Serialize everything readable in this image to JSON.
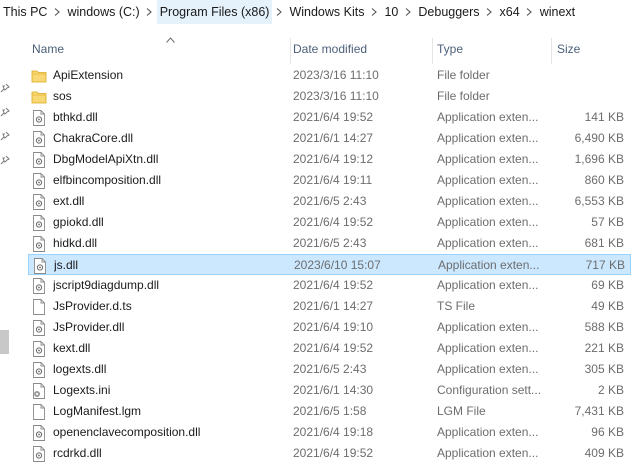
{
  "breadcrumb": {
    "items": [
      "This PC",
      "windows (C:)",
      "Program Files (x86)",
      "Windows Kits",
      "10",
      "Debuggers",
      "x64",
      "winext"
    ]
  },
  "columns": {
    "name": "Name",
    "date": "Date modified",
    "type": "Type",
    "size": "Size"
  },
  "colors": {
    "selected_row_bg": "#cce8ff",
    "selected_row_border": "#99d1ff",
    "header_text": "#4c607a",
    "folder_icon": "#f5c542"
  },
  "files": [
    {
      "name": "ApiExtension",
      "date": "2023/3/16 11:10",
      "type": "File folder",
      "size": "",
      "icon": "folder-icon"
    },
    {
      "name": "sos",
      "date": "2023/3/16 11:10",
      "type": "File folder",
      "size": "",
      "icon": "folder-icon"
    },
    {
      "name": "bthkd.dll",
      "date": "2021/6/4 19:52",
      "type": "Application exten...",
      "size": "141 KB",
      "icon": "dll-file-icon"
    },
    {
      "name": "ChakraCore.dll",
      "date": "2021/6/1 14:27",
      "type": "Application exten...",
      "size": "6,490 KB",
      "icon": "dll-file-icon"
    },
    {
      "name": "DbgModelApiXtn.dll",
      "date": "2021/6/4 19:12",
      "type": "Application exten...",
      "size": "1,696 KB",
      "icon": "dll-file-icon"
    },
    {
      "name": "elfbincomposition.dll",
      "date": "2021/6/4 19:11",
      "type": "Application exten...",
      "size": "860 KB",
      "icon": "dll-file-icon"
    },
    {
      "name": "ext.dll",
      "date": "2021/6/5 2:43",
      "type": "Application exten...",
      "size": "6,553 KB",
      "icon": "dll-file-icon"
    },
    {
      "name": "gpiokd.dll",
      "date": "2021/6/4 19:52",
      "type": "Application exten...",
      "size": "57 KB",
      "icon": "dll-file-icon"
    },
    {
      "name": "hidkd.dll",
      "date": "2021/6/5 2:43",
      "type": "Application exten...",
      "size": "681 KB",
      "icon": "dll-file-icon"
    },
    {
      "name": "js.dll",
      "date": "2023/6/10 15:07",
      "type": "Application exten...",
      "size": "717 KB",
      "icon": "dll-file-icon",
      "selected": true
    },
    {
      "name": "jscript9diagdump.dll",
      "date": "2021/6/4 19:52",
      "type": "Application exten...",
      "size": "69 KB",
      "icon": "dll-file-icon"
    },
    {
      "name": "JsProvider.d.ts",
      "date": "2021/6/1 14:27",
      "type": "TS File",
      "size": "49 KB",
      "icon": "text-file-icon"
    },
    {
      "name": "JsProvider.dll",
      "date": "2021/6/4 19:10",
      "type": "Application exten...",
      "size": "588 KB",
      "icon": "dll-file-icon"
    },
    {
      "name": "kext.dll",
      "date": "2021/6/4 19:52",
      "type": "Application exten...",
      "size": "221 KB",
      "icon": "dll-file-icon"
    },
    {
      "name": "logexts.dll",
      "date": "2021/6/5 2:43",
      "type": "Application exten...",
      "size": "305 KB",
      "icon": "dll-file-icon"
    },
    {
      "name": "Logexts.ini",
      "date": "2021/6/1 14:30",
      "type": "Configuration sett...",
      "size": "2 KB",
      "icon": "config-file-icon"
    },
    {
      "name": "LogManifest.lgm",
      "date": "2021/6/5 1:58",
      "type": "LGM File",
      "size": "7,431 KB",
      "icon": "text-file-icon"
    },
    {
      "name": "openenclavecomposition.dll",
      "date": "2021/6/4 19:18",
      "type": "Application exten...",
      "size": "96 KB",
      "icon": "dll-file-icon"
    },
    {
      "name": "rcdrkd.dll",
      "date": "2021/6/4 19:52",
      "type": "Application exten...",
      "size": "409 KB",
      "icon": "dll-file-icon"
    }
  ]
}
